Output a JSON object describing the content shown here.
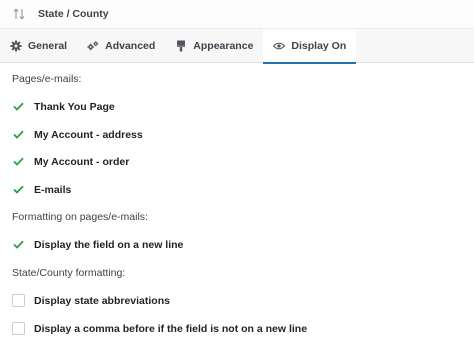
{
  "header": {
    "title": "State / County"
  },
  "tabs": [
    {
      "label": "General",
      "icon": "gear-icon"
    },
    {
      "label": "Advanced",
      "icon": "gears-icon"
    },
    {
      "label": "Appearance",
      "icon": "paintbrush-icon"
    },
    {
      "label": "Display On",
      "icon": "eye-icon"
    }
  ],
  "sections": {
    "pages": {
      "label": "Pages/e-mails:",
      "options": [
        {
          "label": "Thank You Page",
          "checked": true
        },
        {
          "label": "My Account - address",
          "checked": true
        },
        {
          "label": "My Account - order",
          "checked": true
        },
        {
          "label": "E-mails",
          "checked": true
        }
      ]
    },
    "formatting_pages": {
      "label": "Formatting on pages/e-mails:",
      "options": [
        {
          "label": "Display the field on a new line",
          "checked": true
        }
      ]
    },
    "state_formatting": {
      "label": "State/County formatting:",
      "options": [
        {
          "label": "Display state abbreviations",
          "checked": false
        },
        {
          "label": "Display a comma before if the field is not on a new line",
          "checked": false
        }
      ]
    }
  },
  "colors": {
    "check": "#2a9d4b",
    "accent": "#2271b1"
  }
}
